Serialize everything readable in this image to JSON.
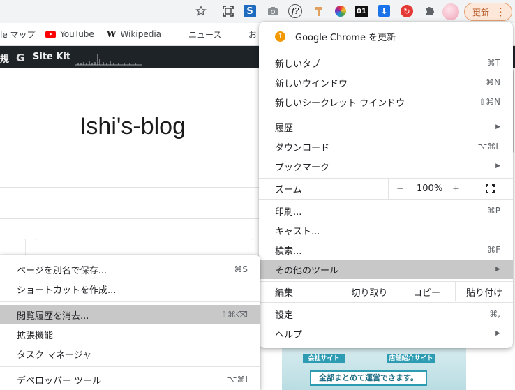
{
  "toolbar": {
    "update_label": "更新",
    "ext_s": "S",
    "ext_f": "f?",
    "ext_01": "01",
    "icons": [
      "star-icon",
      "capture-icon",
      "s-extension-icon",
      "camera-icon",
      "f-extension-icon",
      "highlighter-icon",
      "color-wheel-icon",
      "01-extension-icon",
      "download-extension-icon",
      "red-extension-icon",
      "puzzle-icon",
      "avatar",
      "menu-dots-icon"
    ]
  },
  "bookmarks": {
    "items": [
      {
        "label": "le マップ",
        "icon": "maps-icon"
      },
      {
        "label": "YouTube",
        "icon": "youtube-icon"
      },
      {
        "label": "Wikipedia",
        "icon": "wikipedia-icon"
      },
      {
        "label": "ニュース",
        "icon": "folder-icon"
      },
      {
        "label": "お",
        "icon": "folder-icon"
      }
    ],
    "wiki_glyph": "W"
  },
  "adminbar": {
    "left_text": "規",
    "g_glyph": "G",
    "site_kit": "Site Kit"
  },
  "page": {
    "blog_title": "Ishi's-blog",
    "banner": {
      "left_tag": "会社サイト",
      "right_tag": "店舗紹介サイト",
      "message": "全部まとめて運営できます。"
    }
  },
  "main_menu": {
    "update_item": "Google Chrome を更新",
    "new_tab": {
      "label": "新しいタブ",
      "shortcut": "⌘T"
    },
    "new_window": {
      "label": "新しいウインドウ",
      "shortcut": "⌘N"
    },
    "new_incognito": {
      "label": "新しいシークレット ウインドウ",
      "shortcut": "⇧⌘N"
    },
    "history": {
      "label": "履歴"
    },
    "downloads": {
      "label": "ダウンロード",
      "shortcut": "⌥⌘L"
    },
    "bookmarks": {
      "label": "ブックマーク"
    },
    "zoom": {
      "label": "ズーム",
      "minus": "−",
      "value": "100%",
      "plus": "+"
    },
    "print": {
      "label": "印刷...",
      "shortcut": "⌘P"
    },
    "cast": {
      "label": "キャスト..."
    },
    "find": {
      "label": "検索...",
      "shortcut": "⌘F"
    },
    "more_tools": {
      "label": "その他のツール"
    },
    "edit": {
      "label": "編集",
      "cut": "切り取り",
      "copy": "コピー",
      "paste": "貼り付け"
    },
    "settings": {
      "label": "設定",
      "shortcut": "⌘,"
    },
    "help": {
      "label": "ヘルプ"
    },
    "submenu_arrow": "▶"
  },
  "sub_menu": {
    "save_page": {
      "label": "ページを別名で保存...",
      "shortcut": "⌘S"
    },
    "create_shortcut": {
      "label": "ショートカットを作成..."
    },
    "clear_browsing": {
      "label": "閲覧履歴を消去...",
      "shortcut": "⇧⌘⌫"
    },
    "extensions": {
      "label": "拡張機能"
    },
    "task_manager": {
      "label": "タスク マネージャ"
    },
    "dev_tools": {
      "label": "デベロッパー ツール",
      "shortcut": "⌥⌘I"
    }
  }
}
